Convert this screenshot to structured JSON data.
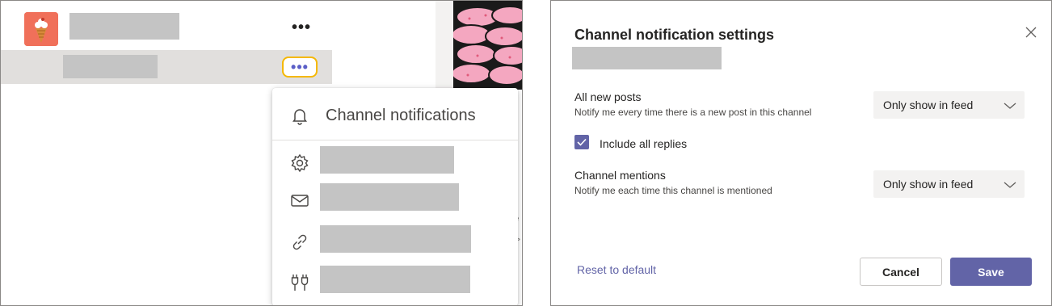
{
  "team": {
    "avatar_icon": "ice-cream-avatar-icon",
    "more_label": "•••",
    "name_redacted": true
  },
  "channel": {
    "more_label": "•••",
    "name_redacted": true,
    "highlight_color": "#f5b800"
  },
  "context_menu": {
    "notifications": {
      "icon": "bell-icon",
      "label": "Channel notifications"
    },
    "items": [
      {
        "icon": "gear-icon",
        "label_redacted": true
      },
      {
        "icon": "mail-icon",
        "label_redacted": true
      },
      {
        "icon": "link-icon",
        "label_redacted": true
      },
      {
        "icon": "connectors-icon",
        "label_redacted": true
      }
    ]
  },
  "dialog": {
    "title": "Channel notification settings",
    "close_icon": "close-icon",
    "channel_name_redacted": true,
    "settings": [
      {
        "title": "All new posts",
        "description": "Notify me every time there is a new post in this channel",
        "value": "Only show in feed"
      },
      {
        "title": "Channel mentions",
        "description": "Notify me each time this channel is mentioned",
        "value": "Only show in feed"
      }
    ],
    "include_replies": {
      "label": "Include all replies",
      "checked": true
    },
    "reset_label": "Reset to default",
    "cancel_label": "Cancel",
    "save_label": "Save",
    "accent_color": "#6264a7"
  }
}
